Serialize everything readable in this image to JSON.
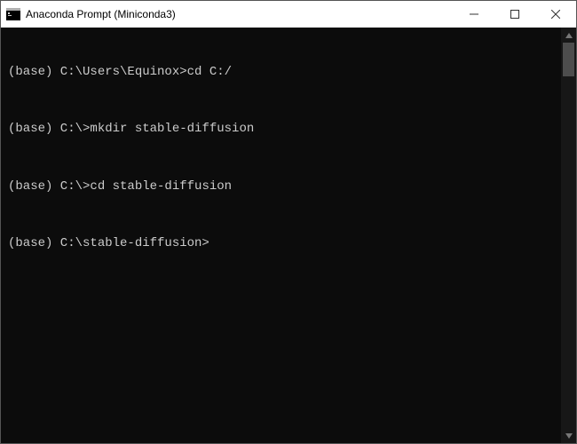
{
  "window": {
    "title": "Anaconda Prompt (Miniconda3)"
  },
  "terminal": {
    "lines": [
      {
        "prompt": "(base) C:\\Users\\Equinox>",
        "command": "cd C:/"
      },
      {
        "prompt": "(base) C:\\>",
        "command": "mkdir stable-diffusion"
      },
      {
        "prompt": "(base) C:\\>",
        "command": "cd stable-diffusion"
      },
      {
        "prompt": "(base) C:\\stable-diffusion>",
        "command": ""
      }
    ]
  }
}
